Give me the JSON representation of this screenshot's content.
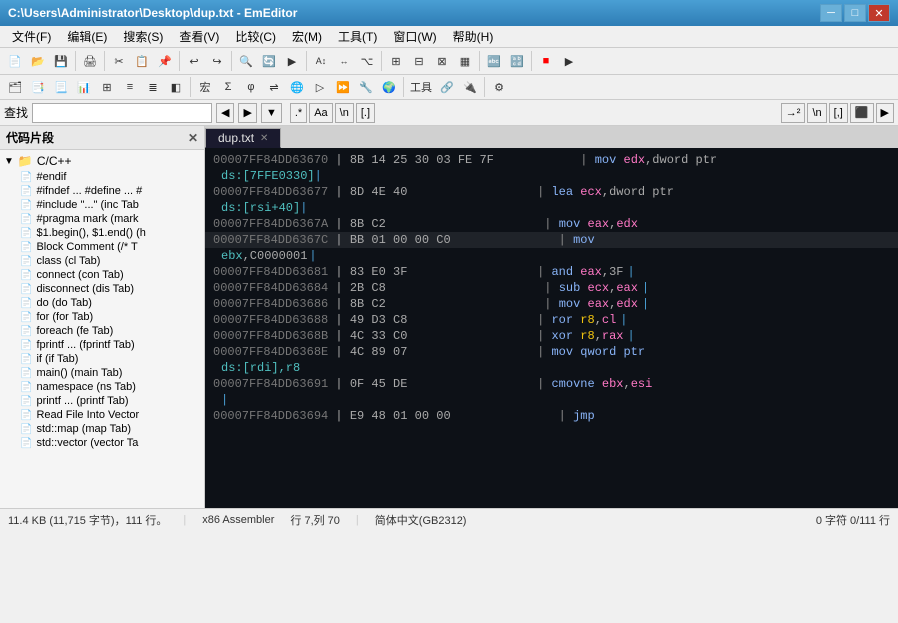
{
  "titlebar": {
    "text": "C:\\Users\\Administrator\\Desktop\\dup.txt - EmEditor",
    "min_label": "─",
    "max_label": "□",
    "close_label": "✕"
  },
  "menubar": {
    "items": [
      "文件(F)",
      "编辑(E)",
      "搜索(S)",
      "查看(V)",
      "比较(C)",
      "宏(M)",
      "工具(T)",
      "窗口(W)",
      "帮助(H)"
    ]
  },
  "search_bar": {
    "label": "查找",
    "placeholder": ""
  },
  "sidebar": {
    "title": "代码片段",
    "items": [
      {
        "label": "C/C++",
        "type": "root",
        "expanded": true
      },
      {
        "label": "#endif",
        "type": "item"
      },
      {
        "label": "#ifndef ... #define ... #",
        "type": "item"
      },
      {
        "label": "#include \"...\" (inc Tab",
        "type": "item"
      },
      {
        "label": "#pragma mark (mark",
        "type": "item"
      },
      {
        "label": "$1.begin(), $1.end() (h",
        "type": "item"
      },
      {
        "label": "Block Comment (/* T",
        "type": "item",
        "selected": false
      },
      {
        "label": "class (cl Tab)",
        "type": "item"
      },
      {
        "label": "connect (con Tab)",
        "type": "item"
      },
      {
        "label": "disconnect (dis Tab)",
        "type": "item"
      },
      {
        "label": "do (do Tab)",
        "type": "item"
      },
      {
        "label": "for (for Tab)",
        "type": "item"
      },
      {
        "label": "foreach (fe Tab)",
        "type": "item"
      },
      {
        "label": "fprintf ... (fprintf Tab)",
        "type": "item"
      },
      {
        "label": "if (if Tab)",
        "type": "item"
      },
      {
        "label": "main() (main Tab)",
        "type": "item"
      },
      {
        "label": "namespace (ns Tab)",
        "type": "item"
      },
      {
        "label": "printf ... (printf Tab)",
        "type": "item"
      },
      {
        "label": "Read File Into Vector",
        "type": "item"
      },
      {
        "label": "std::map (map Tab)",
        "type": "item"
      },
      {
        "label": "std::vector (vector Ta",
        "type": "item"
      }
    ]
  },
  "editor": {
    "tab_name": "dup.txt",
    "lines": [
      {
        "addr": "00007FF84DD63670",
        "bytes": "| 8B 14 25 30 03 FE 7F",
        "spaces": "            ",
        "comment": "| mov edx,dword ptr"
      },
      {
        "addr": "ds:[7FFE0330]",
        "bytes": "",
        "spaces": "",
        "comment": ""
      },
      {
        "addr": "00007FF84DD63677",
        "bytes": "| 8D 4E 40",
        "spaces": "                  ",
        "comment": "| lea ecx,dword ptr"
      },
      {
        "addr": "ds:[rsi+40]",
        "bytes": "",
        "spaces": "",
        "comment": ""
      },
      {
        "addr": "00007FF84DD6367A",
        "bytes": "| 8B C2",
        "spaces": "                      ",
        "comment": "| mov eax,edx"
      },
      {
        "addr": "00007FF84DD6367C",
        "bytes": "| BB 01 00 00 C0",
        "spaces": "               ",
        "comment": "| mov"
      },
      {
        "addr": "ebx,C0000001",
        "bytes": "",
        "spaces": "",
        "comment": ""
      },
      {
        "addr": "00007FF84DD63681",
        "bytes": "| 83 E0 3F",
        "spaces": "                  ",
        "comment": "| and eax,3F"
      },
      {
        "addr": "00007FF84DD63684",
        "bytes": "| 2B C8",
        "spaces": "                      ",
        "comment": "| sub ecx,eax"
      },
      {
        "addr": "00007FF84DD63686",
        "bytes": "| 8B C2",
        "spaces": "                      ",
        "comment": "| mov eax,edx"
      },
      {
        "addr": "00007FF84DD63688",
        "bytes": "| 49 D3 C8",
        "spaces": "                  ",
        "comment": "| ror r8,cl"
      },
      {
        "addr": "00007FF84DD6368B",
        "bytes": "| 4C 33 C0",
        "spaces": "                  ",
        "comment": "| xor r8,rax"
      },
      {
        "addr": "00007FF84DD6368E",
        "bytes": "| 4C 89 07",
        "spaces": "                  ",
        "comment": "| mov qword ptr"
      },
      {
        "addr": "ds:[rdi],r8",
        "bytes": "",
        "spaces": "",
        "comment": ""
      },
      {
        "addr": "00007FF84DD63691",
        "bytes": "| 0F 45 DE",
        "spaces": "                  ",
        "comment": "| cmovne ebx,esi"
      },
      {
        "addr": "",
        "bytes": "",
        "spaces": "",
        "comment": ""
      },
      {
        "addr": "00007FF84DD63694",
        "bytes": "| E9 48 01 00 00",
        "spaces": "               ",
        "comment": "| jmp"
      }
    ]
  },
  "statusbar": {
    "file_size": "11.4 KB (11,715 字节)，111 行。",
    "encoding": "x86 Assembler",
    "position": "行 7,列 70",
    "lang": "简体中文(GB2312)",
    "selection": "0 字符 0/111 行"
  }
}
